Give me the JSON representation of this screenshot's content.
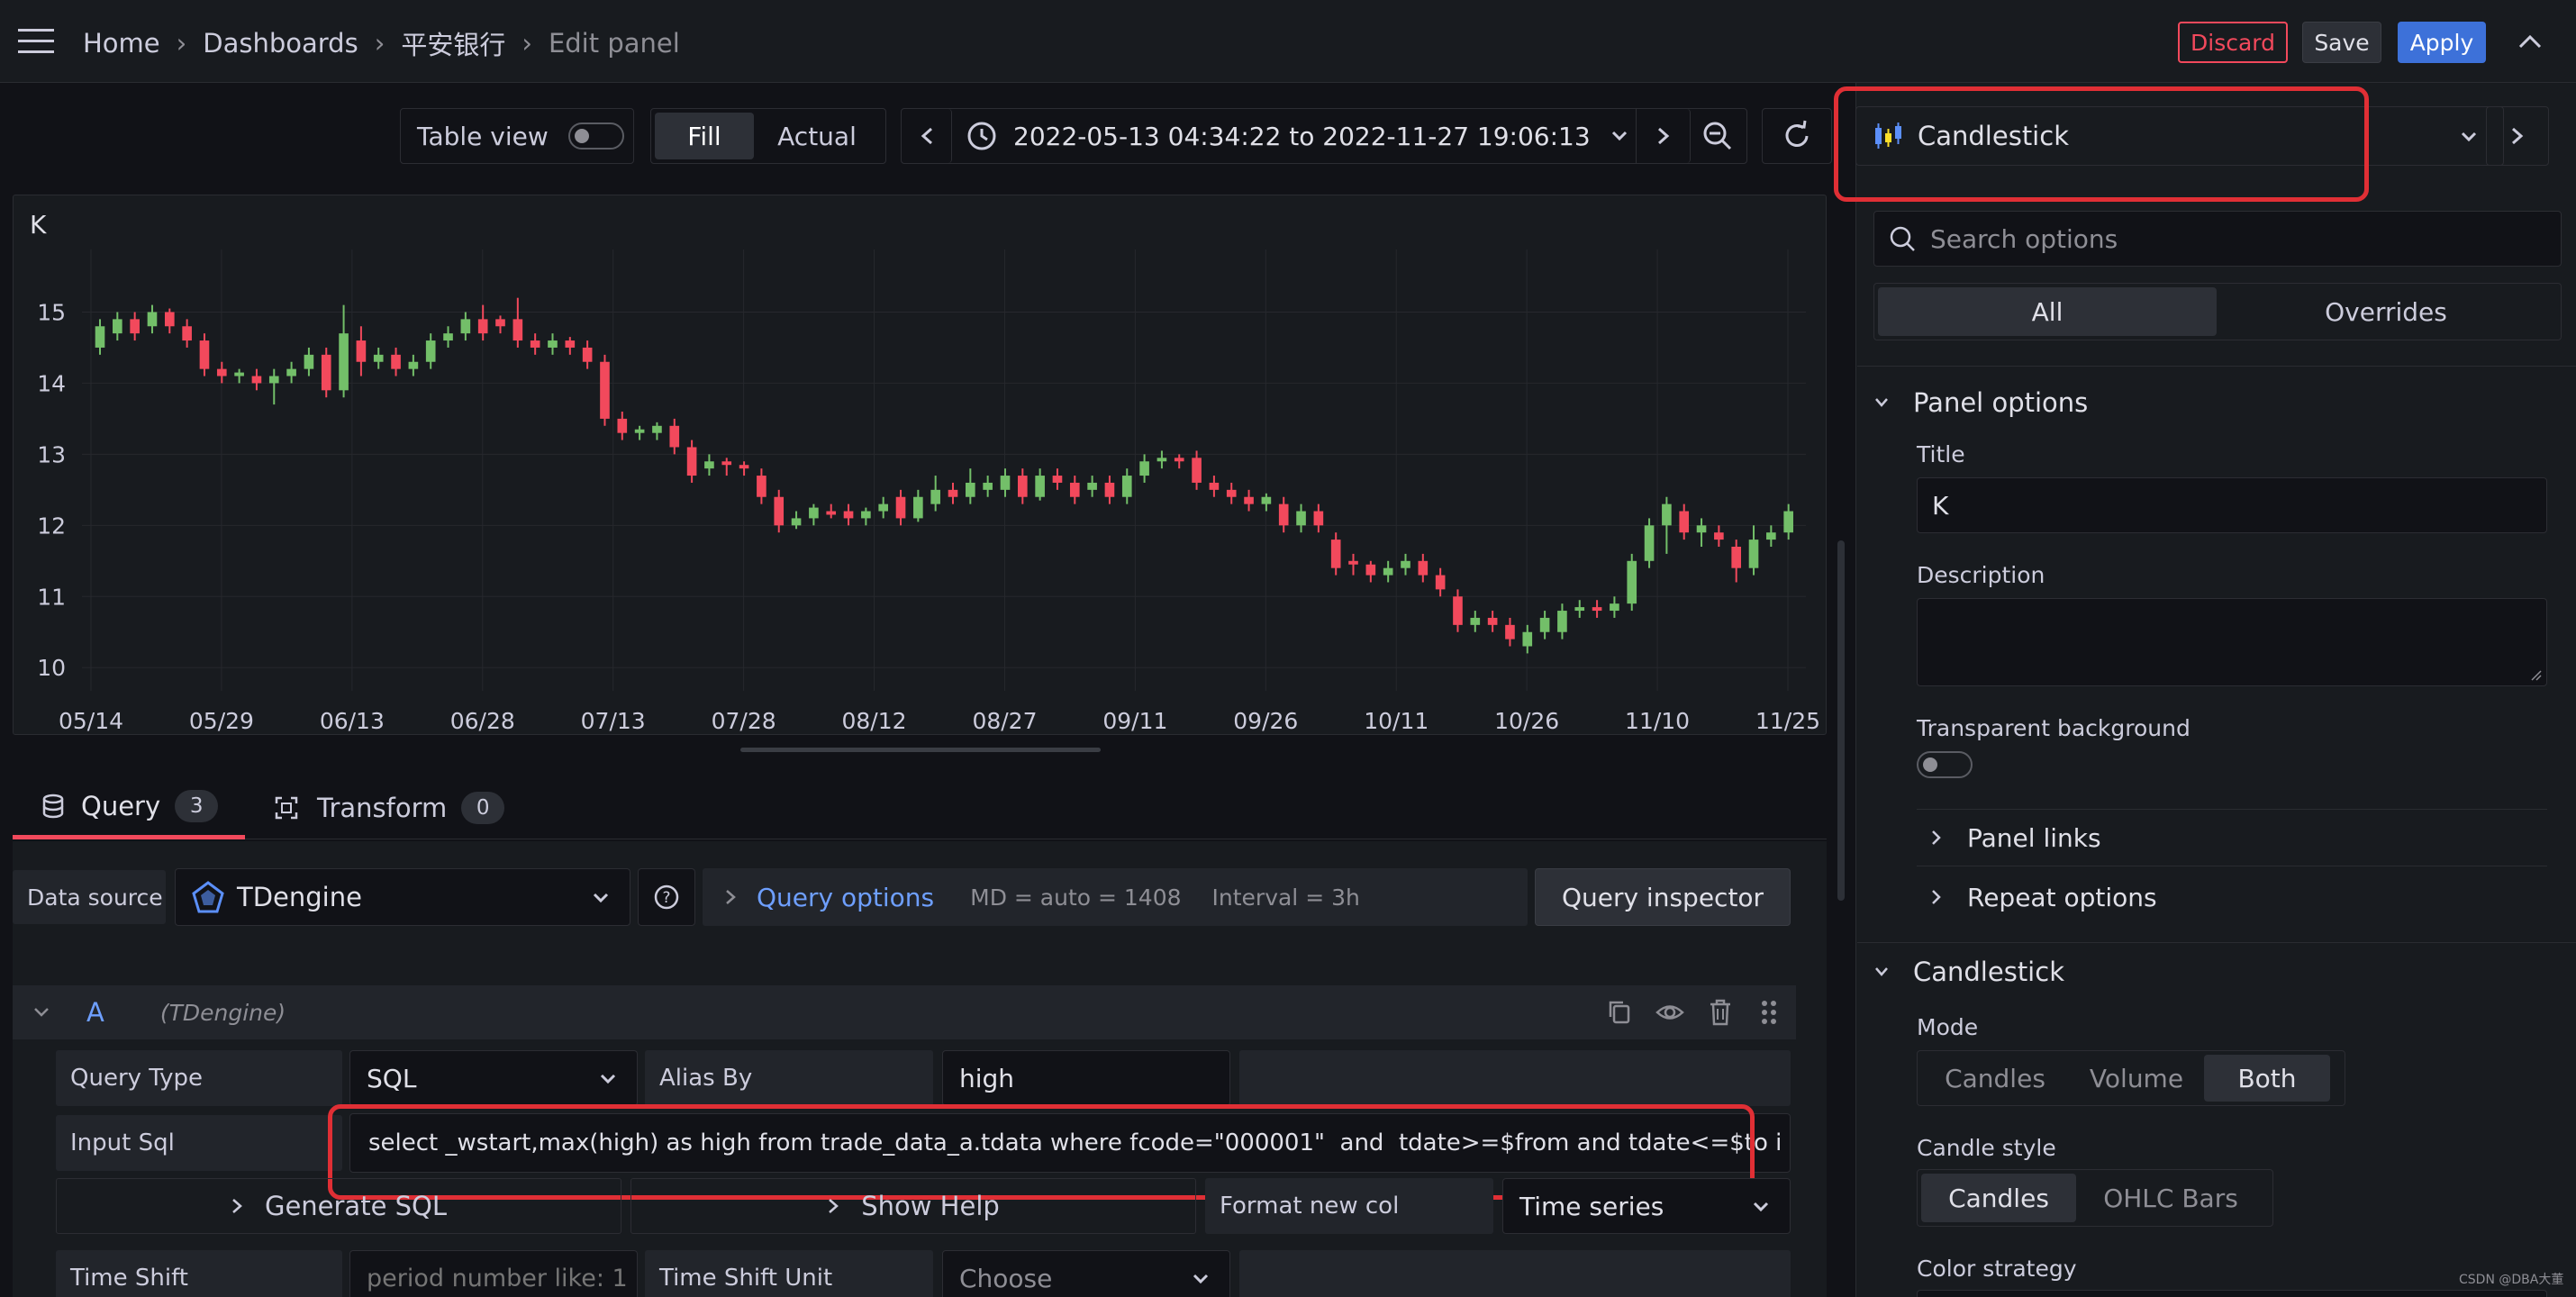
{
  "topnav": {
    "breadcrumbs": [
      "Home",
      "Dashboards",
      "平安银行",
      "Edit panel"
    ],
    "discard": "Discard",
    "save": "Save",
    "apply": "Apply"
  },
  "toolbar": {
    "table_view": "Table view",
    "fill": "Fill",
    "actual": "Actual",
    "time_range": "2022-05-13 04:34:22 to 2022-11-27 19:06:13",
    "visualization": "Candlestick"
  },
  "panel": {
    "title": "K"
  },
  "chart_data": {
    "type": "candlestick",
    "title": "K",
    "xlabel": "",
    "ylabel": "",
    "x_ticks": [
      "05/14",
      "05/29",
      "06/13",
      "06/28",
      "07/13",
      "07/28",
      "08/12",
      "08/27",
      "09/11",
      "09/26",
      "10/11",
      "10/26",
      "11/10",
      "11/25"
    ],
    "y_ticks": [
      15,
      14,
      13,
      12,
      11,
      10
    ],
    "ylim": [
      9.8,
      15.5
    ],
    "candles": [
      {
        "o": 14.5,
        "c": 14.8,
        "h": 14.9,
        "l": 14.4
      },
      {
        "o": 14.7,
        "c": 14.9,
        "h": 15.0,
        "l": 14.6
      },
      {
        "o": 14.9,
        "c": 14.7,
        "h": 15.0,
        "l": 14.6
      },
      {
        "o": 14.8,
        "c": 15.0,
        "h": 15.1,
        "l": 14.7
      },
      {
        "o": 15.0,
        "c": 14.8,
        "h": 15.05,
        "l": 14.7
      },
      {
        "o": 14.8,
        "c": 14.6,
        "h": 14.9,
        "l": 14.5
      },
      {
        "o": 14.6,
        "c": 14.2,
        "h": 14.7,
        "l": 14.1
      },
      {
        "o": 14.2,
        "c": 14.1,
        "h": 14.3,
        "l": 14.0
      },
      {
        "o": 14.1,
        "c": 14.15,
        "h": 14.2,
        "l": 14.0
      },
      {
        "o": 14.1,
        "c": 14.0,
        "h": 14.2,
        "l": 13.9
      },
      {
        "o": 14.0,
        "c": 14.1,
        "h": 14.2,
        "l": 13.7
      },
      {
        "o": 14.1,
        "c": 14.2,
        "h": 14.3,
        "l": 14.0
      },
      {
        "o": 14.2,
        "c": 14.4,
        "h": 14.5,
        "l": 14.1
      },
      {
        "o": 14.4,
        "c": 13.9,
        "h": 14.5,
        "l": 13.8
      },
      {
        "o": 13.9,
        "c": 14.7,
        "h": 15.1,
        "l": 13.8
      },
      {
        "o": 14.6,
        "c": 14.3,
        "h": 14.8,
        "l": 14.1
      },
      {
        "o": 14.3,
        "c": 14.4,
        "h": 14.5,
        "l": 14.2
      },
      {
        "o": 14.4,
        "c": 14.2,
        "h": 14.5,
        "l": 14.1
      },
      {
        "o": 14.2,
        "c": 14.3,
        "h": 14.4,
        "l": 14.1
      },
      {
        "o": 14.3,
        "c": 14.6,
        "h": 14.7,
        "l": 14.2
      },
      {
        "o": 14.6,
        "c": 14.7,
        "h": 14.8,
        "l": 14.5
      },
      {
        "o": 14.7,
        "c": 14.9,
        "h": 15.0,
        "l": 14.6
      },
      {
        "o": 14.9,
        "c": 14.7,
        "h": 15.1,
        "l": 14.6
      },
      {
        "o": 14.9,
        "c": 14.8,
        "h": 14.95,
        "l": 14.7
      },
      {
        "o": 14.9,
        "c": 14.6,
        "h": 15.2,
        "l": 14.5
      },
      {
        "o": 14.6,
        "c": 14.5,
        "h": 14.7,
        "l": 14.4
      },
      {
        "o": 14.5,
        "c": 14.6,
        "h": 14.7,
        "l": 14.4
      },
      {
        "o": 14.6,
        "c": 14.5,
        "h": 14.65,
        "l": 14.4
      },
      {
        "o": 14.5,
        "c": 14.3,
        "h": 14.6,
        "l": 14.2
      },
      {
        "o": 14.3,
        "c": 13.5,
        "h": 14.4,
        "l": 13.4
      },
      {
        "o": 13.5,
        "c": 13.3,
        "h": 13.6,
        "l": 13.2
      },
      {
        "o": 13.3,
        "c": 13.35,
        "h": 13.4,
        "l": 13.2
      },
      {
        "o": 13.3,
        "c": 13.4,
        "h": 13.45,
        "l": 13.2
      },
      {
        "o": 13.4,
        "c": 13.1,
        "h": 13.5,
        "l": 13.0
      },
      {
        "o": 13.1,
        "c": 12.7,
        "h": 13.2,
        "l": 12.6
      },
      {
        "o": 12.8,
        "c": 12.9,
        "h": 13.0,
        "l": 12.7
      },
      {
        "o": 12.9,
        "c": 12.85,
        "h": 12.95,
        "l": 12.7
      },
      {
        "o": 12.85,
        "c": 12.8,
        "h": 12.9,
        "l": 12.7
      },
      {
        "o": 12.7,
        "c": 12.4,
        "h": 12.8,
        "l": 12.3
      },
      {
        "o": 12.4,
        "c": 12.0,
        "h": 12.5,
        "l": 11.9
      },
      {
        "o": 12.0,
        "c": 12.1,
        "h": 12.2,
        "l": 11.95
      },
      {
        "o": 12.1,
        "c": 12.25,
        "h": 12.3,
        "l": 12.0
      },
      {
        "o": 12.2,
        "c": 12.15,
        "h": 12.3,
        "l": 12.1
      },
      {
        "o": 12.2,
        "c": 12.1,
        "h": 12.3,
        "l": 12.0
      },
      {
        "o": 12.1,
        "c": 12.2,
        "h": 12.25,
        "l": 12.0
      },
      {
        "o": 12.2,
        "c": 12.3,
        "h": 12.4,
        "l": 12.1
      },
      {
        "o": 12.4,
        "c": 12.1,
        "h": 12.5,
        "l": 12.0
      },
      {
        "o": 12.1,
        "c": 12.4,
        "h": 12.5,
        "l": 12.05
      },
      {
        "o": 12.3,
        "c": 12.5,
        "h": 12.7,
        "l": 12.2
      },
      {
        "o": 12.5,
        "c": 12.4,
        "h": 12.6,
        "l": 12.3
      },
      {
        "o": 12.4,
        "c": 12.6,
        "h": 12.8,
        "l": 12.3
      },
      {
        "o": 12.5,
        "c": 12.6,
        "h": 12.7,
        "l": 12.4
      },
      {
        "o": 12.5,
        "c": 12.7,
        "h": 12.8,
        "l": 12.4
      },
      {
        "o": 12.7,
        "c": 12.4,
        "h": 12.8,
        "l": 12.3
      },
      {
        "o": 12.4,
        "c": 12.7,
        "h": 12.8,
        "l": 12.35
      },
      {
        "o": 12.7,
        "c": 12.6,
        "h": 12.8,
        "l": 12.5
      },
      {
        "o": 12.6,
        "c": 12.4,
        "h": 12.7,
        "l": 12.3
      },
      {
        "o": 12.5,
        "c": 12.6,
        "h": 12.7,
        "l": 12.4
      },
      {
        "o": 12.6,
        "c": 12.4,
        "h": 12.7,
        "l": 12.3
      },
      {
        "o": 12.4,
        "c": 12.7,
        "h": 12.8,
        "l": 12.3
      },
      {
        "o": 12.7,
        "c": 12.9,
        "h": 13.0,
        "l": 12.6
      },
      {
        "o": 12.9,
        "c": 12.95,
        "h": 13.05,
        "l": 12.8
      },
      {
        "o": 12.95,
        "c": 12.9,
        "h": 13.0,
        "l": 12.8
      },
      {
        "o": 12.95,
        "c": 12.6,
        "h": 13.05,
        "l": 12.5
      },
      {
        "o": 12.6,
        "c": 12.5,
        "h": 12.7,
        "l": 12.4
      },
      {
        "o": 12.5,
        "c": 12.4,
        "h": 12.6,
        "l": 12.3
      },
      {
        "o": 12.4,
        "c": 12.3,
        "h": 12.5,
        "l": 12.2
      },
      {
        "o": 12.3,
        "c": 12.4,
        "h": 12.45,
        "l": 12.2
      },
      {
        "o": 12.3,
        "c": 12.0,
        "h": 12.4,
        "l": 11.9
      },
      {
        "o": 12.0,
        "c": 12.2,
        "h": 12.3,
        "l": 11.9
      },
      {
        "o": 12.2,
        "c": 12.0,
        "h": 12.3,
        "l": 11.9
      },
      {
        "o": 11.8,
        "c": 11.4,
        "h": 11.9,
        "l": 11.3
      },
      {
        "o": 11.5,
        "c": 11.45,
        "h": 11.6,
        "l": 11.3
      },
      {
        "o": 11.45,
        "c": 11.3,
        "h": 11.5,
        "l": 11.2
      },
      {
        "o": 11.3,
        "c": 11.4,
        "h": 11.5,
        "l": 11.2
      },
      {
        "o": 11.4,
        "c": 11.5,
        "h": 11.6,
        "l": 11.3
      },
      {
        "o": 11.5,
        "c": 11.3,
        "h": 11.6,
        "l": 11.2
      },
      {
        "o": 11.3,
        "c": 11.1,
        "h": 11.4,
        "l": 11.0
      },
      {
        "o": 11.0,
        "c": 10.6,
        "h": 11.1,
        "l": 10.5
      },
      {
        "o": 10.6,
        "c": 10.7,
        "h": 10.8,
        "l": 10.5
      },
      {
        "o": 10.7,
        "c": 10.6,
        "h": 10.8,
        "l": 10.5
      },
      {
        "o": 10.6,
        "c": 10.4,
        "h": 10.7,
        "l": 10.3
      },
      {
        "o": 10.3,
        "c": 10.5,
        "h": 10.6,
        "l": 10.2
      },
      {
        "o": 10.5,
        "c": 10.7,
        "h": 10.8,
        "l": 10.4
      },
      {
        "o": 10.5,
        "c": 10.8,
        "h": 10.9,
        "l": 10.4
      },
      {
        "o": 10.8,
        "c": 10.85,
        "h": 10.95,
        "l": 10.7
      },
      {
        "o": 10.85,
        "c": 10.8,
        "h": 10.95,
        "l": 10.7
      },
      {
        "o": 10.8,
        "c": 10.9,
        "h": 11.0,
        "l": 10.7
      },
      {
        "o": 10.9,
        "c": 11.5,
        "h": 11.6,
        "l": 10.8
      },
      {
        "o": 11.5,
        "c": 12.0,
        "h": 12.1,
        "l": 11.4
      },
      {
        "o": 12.0,
        "c": 12.3,
        "h": 12.4,
        "l": 11.6
      },
      {
        "o": 12.2,
        "c": 11.9,
        "h": 12.3,
        "l": 11.8
      },
      {
        "o": 11.9,
        "c": 12.0,
        "h": 12.1,
        "l": 11.7
      },
      {
        "o": 11.9,
        "c": 11.8,
        "h": 12.0,
        "l": 11.7
      },
      {
        "o": 11.7,
        "c": 11.4,
        "h": 11.8,
        "l": 11.2
      },
      {
        "o": 11.4,
        "c": 11.8,
        "h": 12.0,
        "l": 11.3
      },
      {
        "o": 11.8,
        "c": 11.9,
        "h": 12.0,
        "l": 11.7
      },
      {
        "o": 11.9,
        "c": 12.2,
        "h": 12.3,
        "l": 11.8
      }
    ],
    "colors": {
      "up": "#73bf69",
      "down": "#f2495c"
    }
  },
  "query": {
    "tab_query": "Query",
    "query_count": "3",
    "tab_transform": "Transform",
    "transform_count": "0",
    "data_source_label": "Data source",
    "data_source": "TDengine",
    "query_options": "Query options",
    "md": "MD = auto = 1408",
    "interval": "Interval = 3h",
    "inspector": "Query inspector",
    "row_letter": "A",
    "row_ds": "(TDengine)",
    "query_type_label": "Query Type",
    "query_type": "SQL",
    "alias_label": "Alias By",
    "alias": "high",
    "input_sql_label": "Input Sql",
    "input_sql": "select _wstart,max(high) as high from trade_data_a.tdata where fcode=\"000001\"  and  tdate>=$from and tdate<=$to i",
    "generate_sql": "Generate SQL",
    "show_help": "Show Help",
    "format_label": "Format new col",
    "format_value": "Time series",
    "time_shift_label": "Time Shift",
    "time_shift_placeholder": "period number like: 1",
    "time_shift_unit_label": "Time Shift Unit",
    "time_shift_unit": "Choose"
  },
  "options": {
    "search_placeholder": "Search options",
    "tab_all": "All",
    "tab_overrides": "Overrides",
    "panel_options": "Panel options",
    "title_label": "Title",
    "title_value": "K",
    "description_label": "Description",
    "transparent_label": "Transparent background",
    "panel_links": "Panel links",
    "repeat_options": "Repeat options",
    "candlestick_section": "Candlestick",
    "mode_label": "Mode",
    "mode_options": [
      "Candles",
      "Volume",
      "Both"
    ],
    "mode_selected": "Both",
    "candle_style_label": "Candle style",
    "candle_style_options": [
      "Candles",
      "OHLC Bars"
    ],
    "candle_style_selected": "Candles",
    "color_strategy_label": "Color strategy"
  },
  "watermark": "CSDN @DBA大董",
  "colors": {
    "apply": "#3d71d9",
    "discard": "#f2495c",
    "highlight": "#e02f35",
    "link": "#6e9fff"
  }
}
